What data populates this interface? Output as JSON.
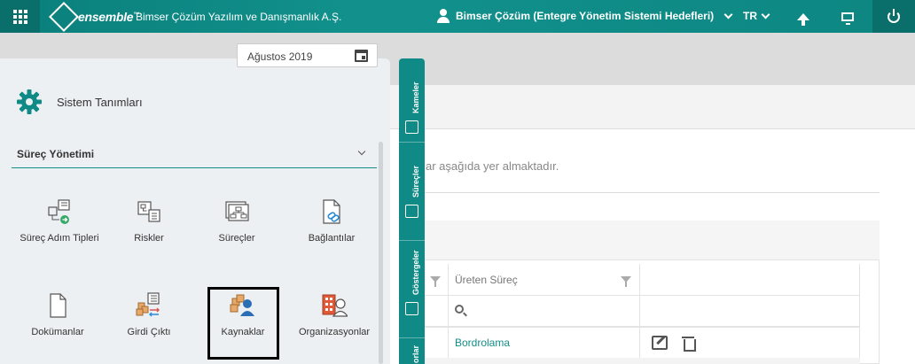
{
  "topbar": {
    "logo": "ensemble",
    "logo_tm": "™",
    "company": "Bimser Çözüm Yazılım ve Danışmanlık A.Ş.",
    "user": "Bimser Çözüm (Entegre Yönetim Sistemi Hedefleri)",
    "language": "TR"
  },
  "date_picker": {
    "value": "Ağustos 2019"
  },
  "panel": {
    "title": "Sistem Tanımları",
    "section": "Süreç Yönetimi",
    "tiles": [
      {
        "label": "Süreç Adım Tipleri",
        "icon": "process-step-types-icon"
      },
      {
        "label": "Riskler",
        "icon": "risks-icon"
      },
      {
        "label": "Süreçler",
        "icon": "processes-icon"
      },
      {
        "label": "Bağlantılar",
        "icon": "links-icon"
      },
      {
        "label": "Dokümanlar",
        "icon": "document-icon"
      },
      {
        "label": "Girdi Çıktı",
        "icon": "input-output-icon"
      },
      {
        "label": "Kaynaklar",
        "icon": "resources-icon"
      },
      {
        "label": "Organizasyonlar",
        "icon": "organizations-icon"
      }
    ]
  },
  "side_tabs": [
    {
      "label": "Kameler",
      "icon": "kameler-icon"
    },
    {
      "label": "Süreçler",
      "icon": "surecler-icon"
    },
    {
      "label": "Göstergeler",
      "icon": "gostergeler-icon"
    },
    {
      "label": "orlar",
      "icon": "raporlar-icon"
    }
  ],
  "background": {
    "description": "ar aşağıda yer almaktadır.",
    "column_header": "Üreten Süreç",
    "row_value": "Bordrolama"
  },
  "colors": {
    "brand": "#0f8a86",
    "link": "#138d89"
  }
}
